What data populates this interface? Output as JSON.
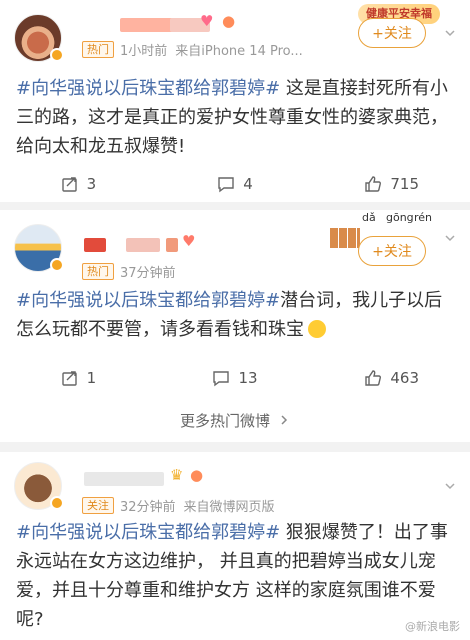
{
  "follow_label": "+关注",
  "more_hot": "更多热门微博",
  "watermark": "@新浪电影",
  "colors": {
    "accent": "#e08a1e",
    "topic": "#4a6ea8",
    "background": "#f2f2f2"
  },
  "posts": [
    {
      "tag": "热门",
      "time": "1小时前",
      "source": "来自iPhone 14 Pro...",
      "banner": "健康平安幸福",
      "topic": "#向华强说以后珠宝都给郭碧婷#",
      "text": " 这是直接封死所有小三的路，这才是真正的爱护女性尊重女性的婆家典范，给向太和龙五叔爆赞!",
      "reposts": "3",
      "comments": "4",
      "likes": "715"
    },
    {
      "tag": "热门",
      "time": "37分钟前",
      "pinyin": [
        "dǎ",
        "gōng",
        "rén"
      ],
      "topic": "#向华强说以后珠宝都给郭碧婷#",
      "text": "潜台词，我儿子以后怎么玩都不要管，请多看看钱和珠宝",
      "reposts": "1",
      "comments": "13",
      "likes": "463"
    },
    {
      "tag": "关注",
      "time": "32分钟前",
      "source": "来自微博网页版",
      "topic": "#向华强说以后珠宝都给郭碧婷#",
      "text": " 狠狠爆赞了！出了事永远站在女方这边维护， 并且真的把碧婷当成女儿宠爱，并且十分尊重和维护女方 这样的家庭氛围谁不爱呢?"
    }
  ]
}
